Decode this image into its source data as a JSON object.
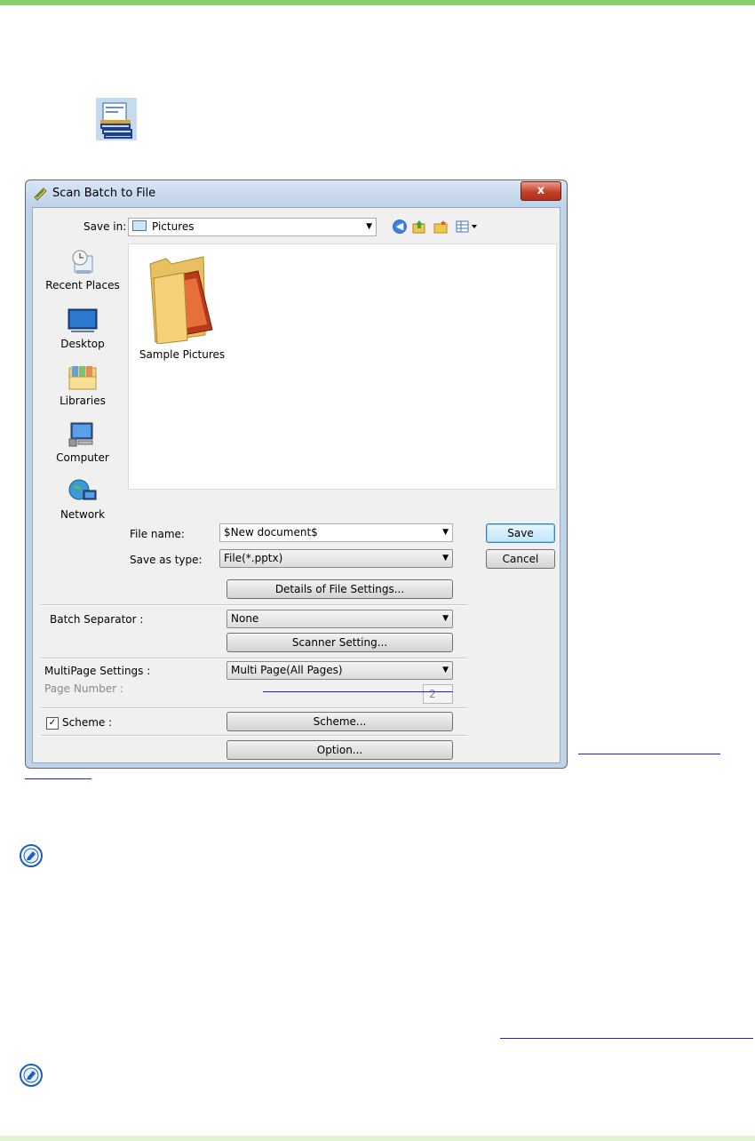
{
  "dialog": {
    "title": "Scan Batch to File",
    "close_label": "x",
    "save_in_label": "Save in:",
    "save_in_value": "Pictures",
    "places": [
      {
        "label": "Recent Places"
      },
      {
        "label": "Desktop"
      },
      {
        "label": "Libraries"
      },
      {
        "label": "Computer"
      },
      {
        "label": "Network"
      }
    ],
    "files": [
      {
        "label": "Sample Pictures"
      }
    ],
    "file_name_label": "File name:",
    "file_name_value": "$New document$",
    "save_as_type_label": "Save as type:",
    "save_as_type_value": "File(*.pptx)",
    "save_button": "Save",
    "cancel_button": "Cancel",
    "details_button": "Details of File Settings...",
    "batch_separator_label": "Batch Separator :",
    "batch_separator_value": "None",
    "scanner_setting_button": "Scanner Setting...",
    "multipage_label": "MultiPage Settings :",
    "multipage_value": "Multi Page(All Pages)",
    "page_number_label": "Page Number :",
    "page_number_value": "2",
    "scheme_label": "Scheme :",
    "scheme_checked": true,
    "scheme_button": "Scheme...",
    "option_button": "Option..."
  },
  "colors": {
    "top_bar": "#8bd16b",
    "bottom_bar": "#dff3d2",
    "note_icon": "#1a5fbf",
    "link": "#2222aa"
  },
  "icons": [
    "scan-batch-icon",
    "note-icon",
    "back-icon",
    "up-folder-icon",
    "new-folder-icon",
    "view-menu-icon"
  ]
}
